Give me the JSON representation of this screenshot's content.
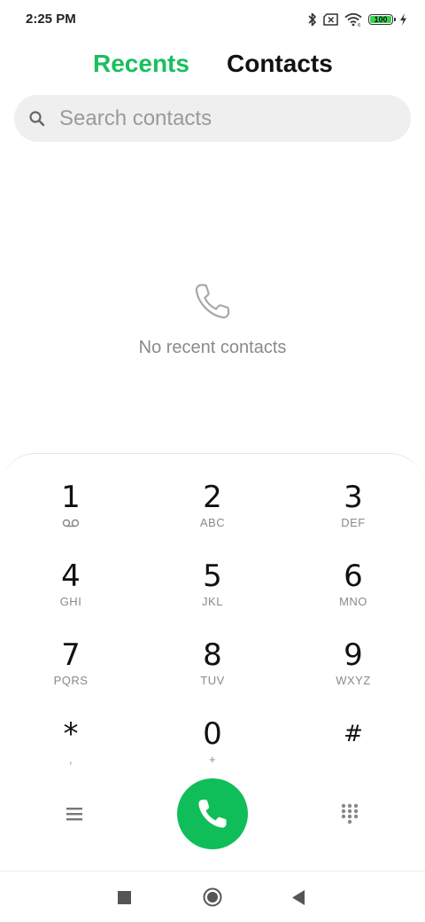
{
  "status_bar": {
    "time": "2:25 PM",
    "battery": "100",
    "icons": [
      "bluetooth-icon",
      "no-sim-icon",
      "wifi-icon",
      "battery-icon",
      "charging-icon"
    ]
  },
  "tabs": [
    {
      "label": "Recents",
      "active": true
    },
    {
      "label": "Contacts",
      "active": false
    }
  ],
  "search": {
    "placeholder": "Search contacts",
    "value": ""
  },
  "empty_state": {
    "icon": "phone-outline-icon",
    "text": "No recent contacts"
  },
  "dialpad": {
    "keys": [
      {
        "digit": "1",
        "letters": ""
      },
      {
        "digit": "2",
        "letters": "ABC"
      },
      {
        "digit": "3",
        "letters": "DEF"
      },
      {
        "digit": "4",
        "letters": "GHI"
      },
      {
        "digit": "5",
        "letters": "JKL"
      },
      {
        "digit": "6",
        "letters": "MNO"
      },
      {
        "digit": "7",
        "letters": "PQRS"
      },
      {
        "digit": "8",
        "letters": "TUV"
      },
      {
        "digit": "9",
        "letters": "WXYZ"
      },
      {
        "digit": "*",
        "letters": ","
      },
      {
        "digit": "0",
        "letters": "+"
      },
      {
        "digit": "#",
        "letters": ""
      }
    ],
    "key1_icon": "voicemail-icon"
  },
  "actions": {
    "menu_icon": "menu-icon",
    "call_icon": "phone-icon",
    "keypad_icon": "dialpad-grid-icon"
  },
  "navbar": {
    "icons": [
      "recents-square-icon",
      "home-circle-icon",
      "back-triangle-icon"
    ]
  },
  "colors": {
    "accent": "#19bf5c",
    "call_button": "#0fbe58",
    "search_bg": "#efefef"
  }
}
